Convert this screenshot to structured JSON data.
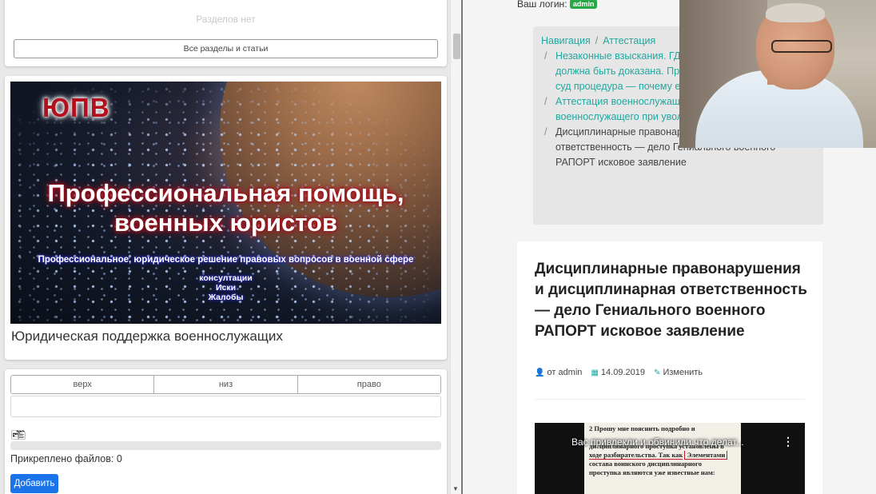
{
  "left": {
    "sections": {
      "empty_text": "Разделов нет",
      "all_button": "Все разделы и статьи"
    },
    "banner": {
      "logo": "ЮПВ",
      "headline_line1": "Профессиональная помощь,",
      "headline_line2": "военных юристов",
      "subtitle": "Профессиональное, юридическое решение правовых вопросов в военной сфере",
      "list": [
        "консултации",
        "Иски",
        "Жалобы"
      ],
      "caption": "Юридическая поддержка военнослужащих"
    },
    "upload": {
      "position_tabs": [
        "верх",
        "низ",
        "право"
      ],
      "input_value": "",
      "attached_text": "Прикреплено файлов: 0",
      "progress": 0,
      "add_button": "Добавить"
    }
  },
  "right": {
    "login_label": "Ваш логин:",
    "login_user": "admin",
    "breadcrumb": {
      "root": "Навигация",
      "separator": "/",
      "second": "Аттестация",
      "items": [
        {
          "text": "Незаконные взыскания. ГД взыскание как доказать ? Ч должна быть доказана. Про ее применять . Образцы суд процедура — почему ее нуж",
          "type": "link"
        },
        {
          "text": "Аттестация военнослужащ аттестации, аттестация военнослужащего при увольнении",
          "type": "link"
        },
        {
          "text": "Дисциплинарные правонарушения и дисциплинарная ответственность — дело Гениального военного РАПОРТ исковое заявление",
          "type": "current"
        }
      ]
    },
    "article": {
      "title": "Дисциплинарные правонарушения и дисциплинарная ответственность — дело Гениального военного РАПОРТ исковое заявление",
      "author_prefix": "от",
      "author": "admin",
      "date": "14.09.2019",
      "edit_label": "Изменить"
    },
    "video": {
      "title": "Вас привлекли и обвинили что делат...",
      "doc_lines": [
        "2 Прошу мне пояснить подробно и",
        "дисциплинарного проступка установлены в",
        "ходе разбирательства. Так как",
        "Элементами",
        "состава воинского дисциплинарного",
        "проступка являются уже известные нам:"
      ]
    }
  },
  "colors": {
    "accent_teal": "#20a8a0",
    "button_blue": "#1a73e8",
    "badge_green": "#28a745"
  }
}
